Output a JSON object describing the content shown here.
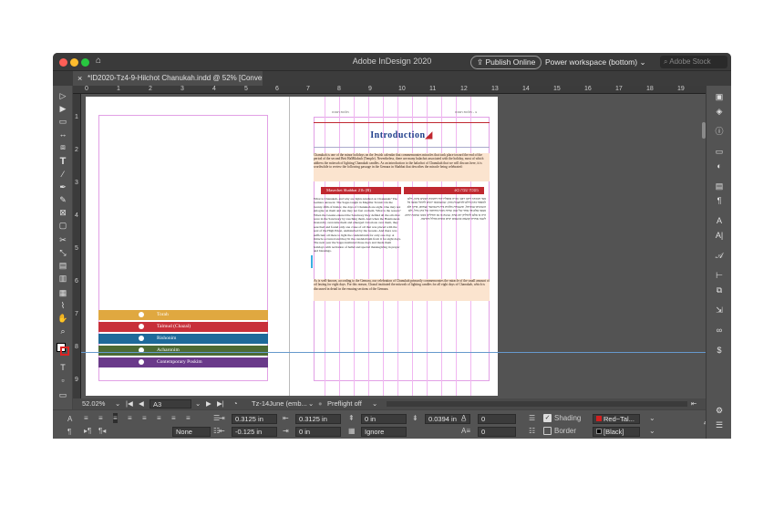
{
  "window": {
    "title": "Adobe InDesign 2020",
    "publish_online": "Publish Online",
    "workspace": "Power workspace (bottom)",
    "search_placeholder": "Adobe Stock"
  },
  "document_tab": {
    "label": "*ID2020-Tz4-9-Hilchot Chanukah.indd @ 52% [Converted]"
  },
  "ruler_h": [
    "0",
    "1",
    "2",
    "3",
    "4",
    "5",
    "6",
    "7",
    "8",
    "9",
    "10",
    "11",
    "12",
    "13",
    "14",
    "15",
    "16",
    "17",
    "18",
    "19"
  ],
  "ruler_v": [
    "1",
    "2",
    "3",
    "4",
    "5",
    "6",
    "7",
    "8",
    "9"
  ],
  "left_page": {
    "bands": [
      {
        "label": "Torah",
        "color": "#e0a840"
      },
      {
        "label": "Talmud (Chazal)",
        "color": "#c8303a"
      },
      {
        "label": "Rishonim",
        "color": "#1e6a9a"
      },
      {
        "label": "Acharonim",
        "color": "#4c6a34"
      },
      {
        "label": "Contemporary Poskim",
        "color": "#6a3a8a"
      }
    ]
  },
  "right_page": {
    "header_left": "הלכות חנוכה",
    "header_right": "ב - הלכות חנוכה",
    "title": "Introduction",
    "intro_text": "Chanukah is one of the minor holidays on the Jewish calendar that commemorates miracles that took place toward the end of the period of the second Beit HaMikdash (Temple). Nevertheless, there are many halachot associated with the holiday, most of which address the mitzvah of lighting Chanukah candles. As an introduction to the halachot of Chanukah that we will discuss here, it is worthwhile to review the following passage in the Gemara in Shabbat that describes the miracle being celebrated:",
    "left_sub": "Masechet Shabbat 21b (R)",
    "right_sub": "מסכת שבת כא:",
    "left_col": "What is Chanukah, and why are lights kindled on Chanukah? The Gemara answers: The Sages taught in Megillat Ta'anit: On the twenty-fifth of Kislev, the days of Chanukah are eight. One may not eulogize on them and one may not fast on them. What is the reason? When the Greeks entered the Sanctuary they defiled all the oils that were in the Sanctuary by touching them. And when the Hasmonean monarchy overcame them and emerged victorious over them, they searched and found only one cruse of oil that was placed with the seal of the High Priest, undisturbed by the Greeks. And there was sufficient oil there to light the candelabrum for only one day. A miracle occurred and they lit the candelabrum from it for eight days. The next year the Sages instituted those days and made them holidays with recitation of hallel and special thanksgiving in prayer and blessings.",
    "right_col": "מאי חנוכה? דתנו רבנן: בכ״ה בכסליו יומי דחנוכה תמניא אינון, דלא למספד בהון ודלא להתענות בהון. שכשנכנסו יוונים להיכל טמאו כל השמנים שבהיכל, וכשגברה מלכות בית חשמונאי ונצחום, בדקו ולא מצאו אלא פך אחד של שמן שהיה מונח בחותמו של כהן גדול, ולא היה בו אלא להדליק יום אחד, נעשה בו נס והדליקו ממנו שמונה ימים. לשנה אחרת קבעום ועשאום ימים טובים בהלל והודאה.",
    "bottom_text": "As is well-known, according to the Gemara, our celebration of Chanukah primarily commemorates the miracle of the small amount of oil lasting for eight days. For this reason, Chazal instituted the mitzvah of lighting candles for all eight days of Chanukah, which is discussed in detail in the ensuing sections of the Gemara."
  },
  "status": {
    "zoom": "52.02%",
    "page": "A3",
    "style": "Tz-14June (emb...",
    "preflight": "Preflight off"
  },
  "control": {
    "field1": "0.3125 in",
    "field2": "0.3125 in",
    "field3": "0 in",
    "field4": "0.0394 in",
    "field5": "0",
    "field6": "0",
    "field7": "-0.125 in",
    "field8": "0 in",
    "field9": "0",
    "field10": "0",
    "none_label": "None",
    "ignore_label": "Ignore",
    "shading_label": "Shading",
    "border_label": "Border",
    "shading_swatch": "Red~Tal...",
    "border_swatch": "[Black]"
  },
  "colors": {
    "title_blue": "#1d3d8a",
    "accent_red": "#c02830",
    "text_bg": "#fbe4cf"
  }
}
